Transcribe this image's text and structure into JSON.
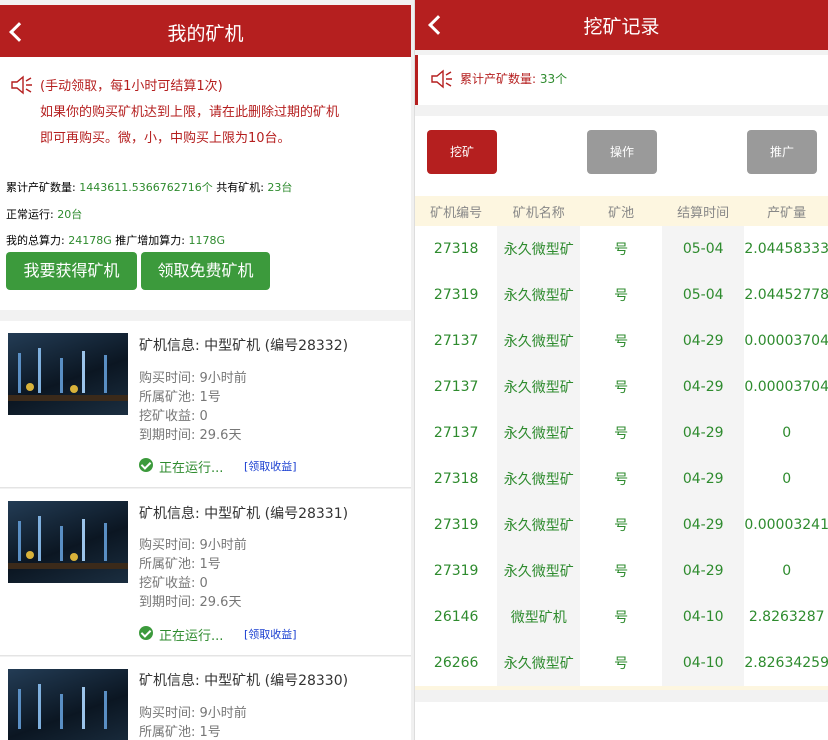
{
  "left": {
    "title": "我的矿机",
    "notice": {
      "line1": "(手动领取，每1小时可结算1次)",
      "line2": "如果你的购买矿机达到上限，请在此删除过期的矿机",
      "line3": "即可再购买。微，小，中购买上限为10台。"
    },
    "stats": {
      "total_label": "累计产矿数量:",
      "total_value": "1443611.5366762716个",
      "machines_label": "共有矿机:",
      "machines_value": "23台",
      "running_label": "正常运行:",
      "running_value": "20台",
      "power_label": "我的总算力:",
      "power_value": "24178G",
      "promo_label": "推广增加算力:",
      "promo_value": "1178G"
    },
    "buttons": {
      "get_machine": "我要获得矿机",
      "free_machine": "领取免费矿机"
    },
    "cards": [
      {
        "title": "矿机信息: 中型矿机 (编号28332)",
        "buy_time": "购买时间: 9小时前",
        "pool": "所属矿池: 1号",
        "income": "挖矿收益: 0",
        "expire": "到期时间: 29.6天",
        "status": "正在运行...",
        "collect": "[领取收益]"
      },
      {
        "title": "矿机信息: 中型矿机 (编号28331)",
        "buy_time": "购买时间: 9小时前",
        "pool": "所属矿池: 1号",
        "income": "挖矿收益: 0",
        "expire": "到期时间: 29.6天",
        "status": "正在运行...",
        "collect": "[领取收益]"
      },
      {
        "title": "矿机信息: 中型矿机 (编号28330)",
        "buy_time": "购买时间: 9小时前",
        "pool": "所属矿池: 1号"
      }
    ]
  },
  "right": {
    "title": "挖矿记录",
    "total_label": "累计产矿数量:",
    "total_value": "33个",
    "tabs": [
      "挖矿",
      "操作",
      "推广"
    ],
    "headers": [
      "矿机编号",
      "矿机名称",
      "矿池",
      "结算时间",
      "产矿量"
    ],
    "rows": [
      [
        "27318",
        "永久微型矿",
        "号",
        "05-04",
        "2.04458333"
      ],
      [
        "27319",
        "永久微型矿",
        "号",
        "05-04",
        "2.04452778"
      ],
      [
        "27137",
        "永久微型矿",
        "号",
        "04-29",
        "0.00003704"
      ],
      [
        "27137",
        "永久微型矿",
        "号",
        "04-29",
        "0.00003704"
      ],
      [
        "27137",
        "永久微型矿",
        "号",
        "04-29",
        "0"
      ],
      [
        "27318",
        "永久微型矿",
        "号",
        "04-29",
        "0"
      ],
      [
        "27319",
        "永久微型矿",
        "号",
        "04-29",
        "0.00003241"
      ],
      [
        "27319",
        "永久微型矿",
        "号",
        "04-29",
        "0"
      ],
      [
        "26146",
        "微型矿机",
        "号",
        "04-10",
        "2.8263287"
      ],
      [
        "26266",
        "永久微型矿",
        "号",
        "04-10",
        "2.82634259"
      ]
    ],
    "colors": {
      "brand": "#b51f1f",
      "active_tab": "#b51f1f",
      "inactive_tab": "#9a9a9a",
      "value": "#2e8b2e"
    }
  }
}
